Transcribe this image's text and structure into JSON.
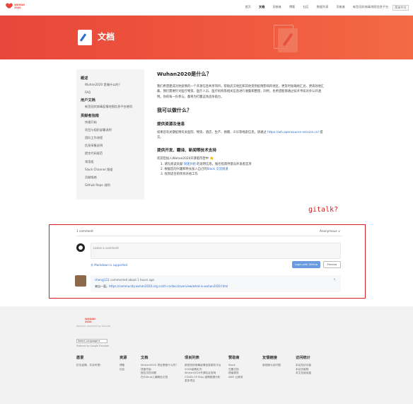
{
  "header": {
    "logo_text_top": "WUHAN",
    "logo_text_bottom": "2020",
    "nav": [
      "首页",
      "文档",
      "贡献者",
      "博客",
      "社区",
      "数据列表",
      "贡献者",
      "新型冠状病毒地图信息平台"
    ],
    "lang_button": "简体中文"
  },
  "hero": {
    "title": "文档"
  },
  "sidebar": {
    "sections": [
      {
        "title": "概述",
        "items": [
          "Wuhan2020 是做什么的？",
          "FAQ"
        ]
      },
      {
        "title": "用户文档",
        "items": [
          "新型冠状病毒疫情地图信息平台使用"
        ]
      },
      {
        "title": "贡献者指南",
        "items": [
          "快速开始",
          "项目与组织部署说明",
          "团队工作流程",
          "信息采集说明",
          "提交代码规范",
          "常用组",
          "Slack Channel 频道",
          "贡献指南",
          "Github Repo 说明"
        ]
      }
    ]
  },
  "content": {
    "h1": "Wuhan2020是什么？",
    "p1": "我们希望建成对抗疫情的一个开源信息共享项目，帮助武汉地区和其他受到疫情影响的地区，更及时准确地汇总、更高效地汇集、我们需要针对医疗物资、医疗人员、医疗机构等相关信息进行收集和整理，同时，也希望能够通过技术手段对外公开透明。你的每一份参与，都将为打赢这场战争助力。",
    "h2": "我可以做什么？",
    "h3a": "提供资源及信息",
    "p2a": "如果您有关键疫情有关医院、物资、酒店、生产、捐赠、义诊等线索信息，请通过 ",
    "p2link": "https://wh.opensource-service.cn/",
    "p2b": " 提交。",
    "h3b": "提供开发、翻译、新闻等技术支持",
    "p3": "欢迎您加入Wuhan2020开源者阵营中 👏",
    "ol": [
      {
        "pre": "1. 请先阅读贡献 ",
        "link": "快速开始",
        "post": " 的说明信息，报名指南供意向开发者选项"
      },
      {
        "pre": "2. 根据您的兴趣和特长加入自己的",
        "link": "Slack 交流频道",
        "post": ""
      },
      {
        "pre": "3. 找到适合的项目开始工作",
        "link": "",
        "post": ""
      }
    ]
  },
  "annotation": "gitalk?",
  "gitalk": {
    "count": "1 comment",
    "user": "Anonymous ∨",
    "placeholder": "Leave a comment",
    "markdown": "Ⓜ Markdown is supported",
    "login": "Login with GitHub",
    "preview": "Preview",
    "comment_user": "chenyj111",
    "comment_meta": " commented about 1 hours ago",
    "comment_body_pre": "来自一面。",
    "comment_link": "https://community.wuhan2020.org.cn/zh-cn/docs/overview/what-is-wuhan2020.html",
    "reply": "↰"
  },
  "footer": {
    "logo_top": "WUHAN",
    "logo_bottom": "2020",
    "sub": "Website powered by Docsite",
    "select": "Select Language ▾",
    "powered": "Powered by Google Translate",
    "columns": [
      {
        "title": "愿景",
        "items": [
          "抗击疫情，共克时艰！"
        ]
      },
      {
        "title": "资源",
        "items": [
          "博客",
          "社区"
        ]
      },
      {
        "title": "文档",
        "items": [
          "Wuhan2020 项目是做什么的？",
          "快速开始",
          "报告文档问题",
          "在Github上编辑此文档"
        ]
      },
      {
        "title": "项目列表",
        "items": [
          "新型冠状病毒疫情信息服务平台",
          "2020疫情实况",
          "Wuhan2020开源社区官网",
          "COVID-19 Stay 疫情数据分析",
          "更多项目"
        ]
      },
      {
        "title": "赞助商",
        "items": [
          "Slack",
          "石墨文档",
          "语雀服务",
          "AWS 云服务"
        ]
      },
      {
        "title": "友情链接",
        "items": [
          "新冠肺炎实时图"
        ]
      },
      {
        "title": "访问统计",
        "items": [
          "本站总访问量",
          "本站访客数",
          "本文总阅读量"
        ]
      }
    ]
  },
  "colors": {
    "brand": "#e8463a",
    "link": "#2b6dc9",
    "annotation": "#d42020"
  }
}
